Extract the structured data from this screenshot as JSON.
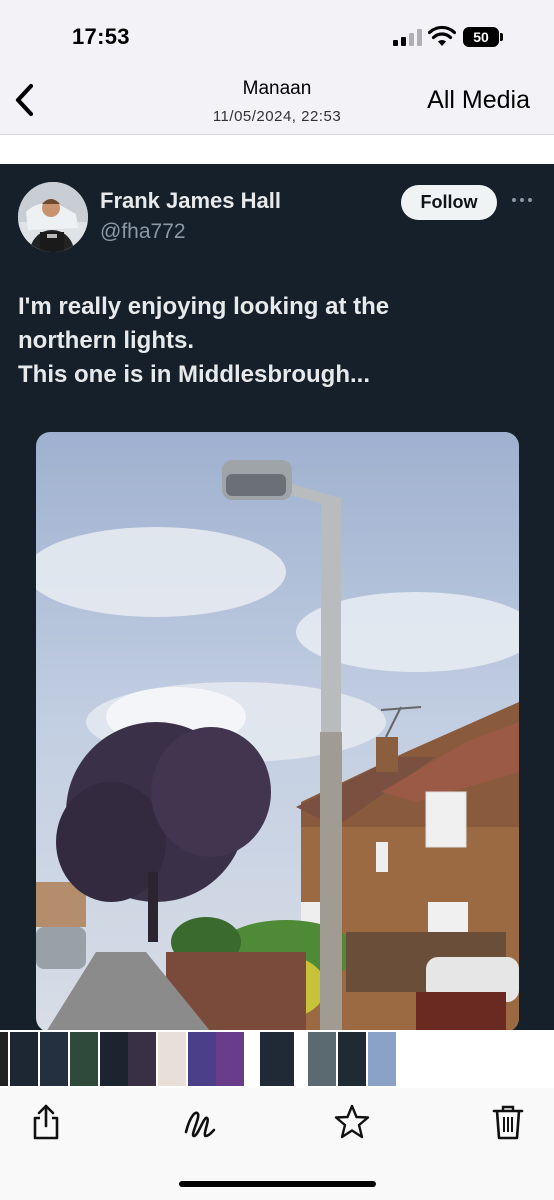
{
  "status_bar": {
    "time": "17:53",
    "battery": "50"
  },
  "nav": {
    "back_icon": "chevron-left-icon",
    "title": "Manaan",
    "subtitle": "11/05/2024, 22:53",
    "right_label": "All Media"
  },
  "tweet": {
    "user_name": "Frank James Hall",
    "user_handle": "@fha772",
    "follow_label": "Follow",
    "text_lines": [
      "I'm really enjoying looking at the",
      "northern lights.",
      "This one is in Middlesbrough..."
    ],
    "media_description_icon": "photo-streetlamp-houses"
  },
  "thumbnails": {
    "count": 15
  },
  "toolbar": {
    "share_icon": "share-icon",
    "markup_icon": "markup-icon",
    "favorite_icon": "star-icon",
    "delete_icon": "trash-icon"
  },
  "colors": {
    "tweet_background": "#15202b",
    "tweet_text": "#e7e9ea",
    "handle_text": "#8b98a5",
    "follow_button": "#eff3f4",
    "app_background": "#f2f2f7"
  }
}
